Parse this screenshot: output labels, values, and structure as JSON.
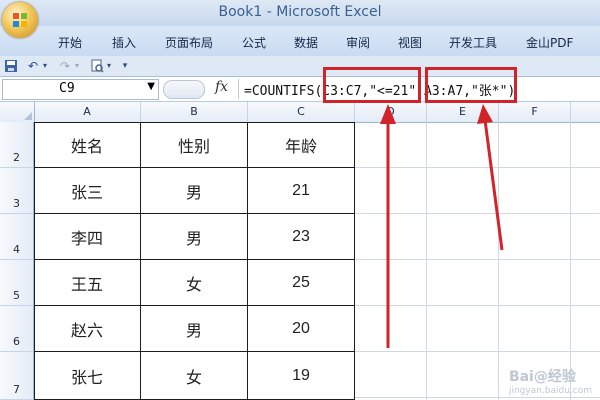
{
  "window": {
    "title": "Book1 - Microsoft Excel"
  },
  "ribbon": {
    "tabs": [
      "开始",
      "插入",
      "页面布局",
      "公式",
      "数据",
      "审阅",
      "视图",
      "开发工具",
      "金山PDF"
    ]
  },
  "quick_access": {
    "icons": [
      "save-icon",
      "undo-icon",
      "redo-icon",
      "print-preview-icon",
      "customize-icon"
    ]
  },
  "formula_bar": {
    "name_box": "C9",
    "fx_label": "fx",
    "formula": "=COUNTIFS(C3:C7,\"<=21\",A3:A7,\"张*\")"
  },
  "grid": {
    "columns": [
      "A",
      "B",
      "C",
      "D",
      "E",
      "F"
    ],
    "rows": [
      "2",
      "3",
      "4",
      "5",
      "6",
      "7"
    ],
    "table": {
      "headers": [
        "姓名",
        "性别",
        "年龄"
      ],
      "rows": [
        [
          "张三",
          "男",
          "21"
        ],
        [
          "李四",
          "男",
          "23"
        ],
        [
          "王五",
          "女",
          "25"
        ],
        [
          "赵六",
          "男",
          "20"
        ],
        [
          "张七",
          "女",
          "19"
        ]
      ]
    }
  },
  "annotations": {
    "highlight_color": "#d2232a"
  },
  "watermark": {
    "main": "Bai@经验",
    "sub": "jingyan.baidu.com"
  }
}
